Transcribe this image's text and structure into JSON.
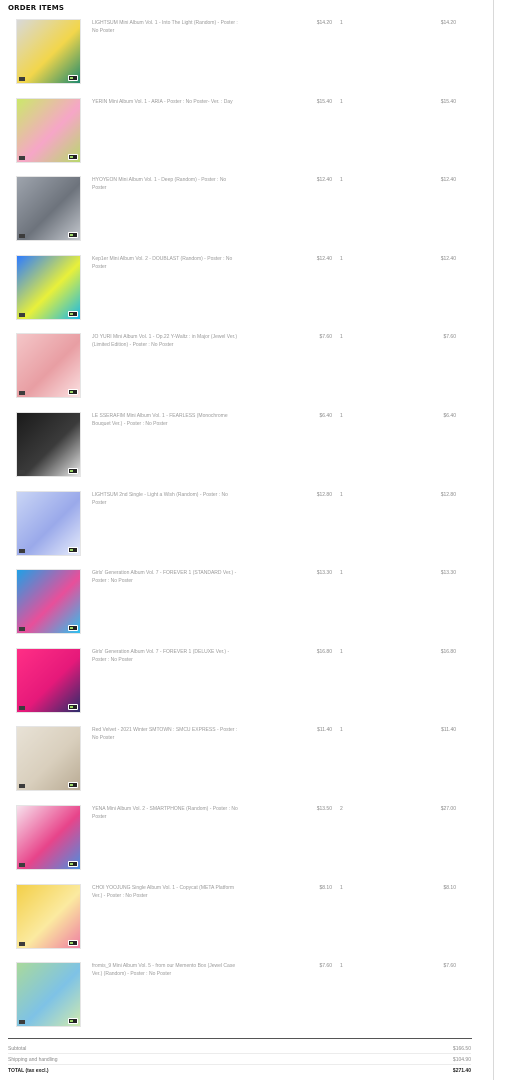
{
  "section": {
    "title": "ORDER ITEMS"
  },
  "items": [
    {
      "name": "LIGHTSUM Mini Album Vol. 1 - Into The Light (Random) - Poster : No Poster",
      "price": "$14.20",
      "qty": "1",
      "total": "$14.20",
      "cover_icon": "album-cover-into-the-light-icon",
      "colors": [
        "#d8d8d8",
        "#f2d64b",
        "#1f8a6e"
      ]
    },
    {
      "name": "YERIN Mini Album Vol. 1 - ARIA - Poster : No Poster- Ver. : Day",
      "price": "$15.40",
      "qty": "1",
      "total": "$15.40",
      "cover_icon": "album-cover-aria-icon",
      "colors": [
        "#cbe86a",
        "#f6a6c7",
        "#b7d86c"
      ]
    },
    {
      "name": "HYOYEON Mini Album Vol. 1 - Deep (Random) - Poster : No Poster",
      "price": "$12.40",
      "qty": "1",
      "total": "$12.40",
      "cover_icon": "album-cover-deep-icon",
      "colors": [
        "#9ea4ad",
        "#6d737c",
        "#c5c9cf"
      ]
    },
    {
      "name": "Kep1er Mini Album Vol. 2 - DOUBLAST (Random) - Poster : No Poster",
      "price": "$12.40",
      "qty": "1",
      "total": "$12.40",
      "cover_icon": "album-cover-doublast-icon",
      "colors": [
        "#2d7cff",
        "#e8f03a",
        "#17b8e8"
      ]
    },
    {
      "name": "JO YURI Mini Album Vol. 1 - Op.22 Y-Waltz : in Major (Jewel Ver.) (Limited Edition) - Poster : No Poster",
      "price": "$7.60",
      "qty": "1",
      "total": "$7.60",
      "cover_icon": "album-cover-op22-icon",
      "colors": [
        "#f4c6c8",
        "#e89ea3",
        "#fbe1e2"
      ]
    },
    {
      "name": "LE SSERAFIM Mini Album Vol. 1 - FEARLESS (Monochrome Bouquet Ver.) - Poster : No Poster",
      "price": "$6.40",
      "qty": "1",
      "total": "$6.40",
      "cover_icon": "album-cover-fearless-icon",
      "colors": [
        "#1a1a1a",
        "#3b3b3b",
        "#e9e9e9"
      ]
    },
    {
      "name": "LIGHTSUM 2nd Single - Light a Wish (Random) - Poster : No Poster",
      "price": "$12.80",
      "qty": "1",
      "total": "$12.80",
      "cover_icon": "album-cover-light-a-wish-icon",
      "colors": [
        "#c9d5f5",
        "#9aa9ea",
        "#e7ecfb"
      ]
    },
    {
      "name": "Girls' Generation Album Vol. 7 - FOREVER 1 (STANDARD Ver.) - Poster : No Poster",
      "price": "$13.30",
      "qty": "1",
      "total": "$13.30",
      "cover_icon": "album-cover-forever1-standard-icon",
      "colors": [
        "#1fa0e6",
        "#e84f9a",
        "#2bc2f0"
      ]
    },
    {
      "name": "Girls' Generation Album Vol. 7 - FOREVER 1 (DELUXE Ver.) - Poster : No Poster",
      "price": "$16.80",
      "qty": "1",
      "total": "$16.80",
      "cover_icon": "album-cover-forever1-deluxe-icon",
      "colors": [
        "#ff2f86",
        "#e6197a",
        "#2b2d6b"
      ]
    },
    {
      "name": "Red Velvet - 2021 Winter SMTOWN : SMCU EXPRESS - Poster : No Poster",
      "price": "$11.40",
      "qty": "1",
      "total": "$11.40",
      "cover_icon": "album-cover-smcu-express-icon",
      "colors": [
        "#e8e2d6",
        "#d9cfbd",
        "#b9ab94"
      ]
    },
    {
      "name": "YENA Mini Album Vol. 2 - SMARTPHONE (Random) - Poster : No Poster",
      "price": "$13.50",
      "qty": "2",
      "total": "$27.00",
      "cover_icon": "album-cover-smartphone-icon",
      "colors": [
        "#f7e1ec",
        "#e8448a",
        "#4a8fe0"
      ]
    },
    {
      "name": "CHOI YOOJUNG Single Album Vol. 1 - Copycat (META Platform Ver.) - Poster : No Poster",
      "price": "$8.10",
      "qty": "1",
      "total": "$8.10",
      "cover_icon": "album-cover-copycat-icon",
      "colors": [
        "#f3cf48",
        "#fbeaa0",
        "#ef7fa2"
      ]
    },
    {
      "name": "fromis_9 Mini Album Vol. 5 - from our Memento Box (Jewel Case Ver.) (Random) - Poster : No Poster",
      "price": "$7.60",
      "qty": "1",
      "total": "$7.60",
      "cover_icon": "album-cover-memento-box-icon",
      "colors": [
        "#a9d99b",
        "#7ec2e6",
        "#cfe9ae"
      ]
    }
  ],
  "totals": {
    "subtotal_label": "Subtotal",
    "subtotal_value": "$166.50",
    "shipping_label": "Shipping and handling",
    "shipping_value": "$104.90",
    "total_label": "TOTAL (tax excl.)",
    "total_value": "$271.40"
  }
}
